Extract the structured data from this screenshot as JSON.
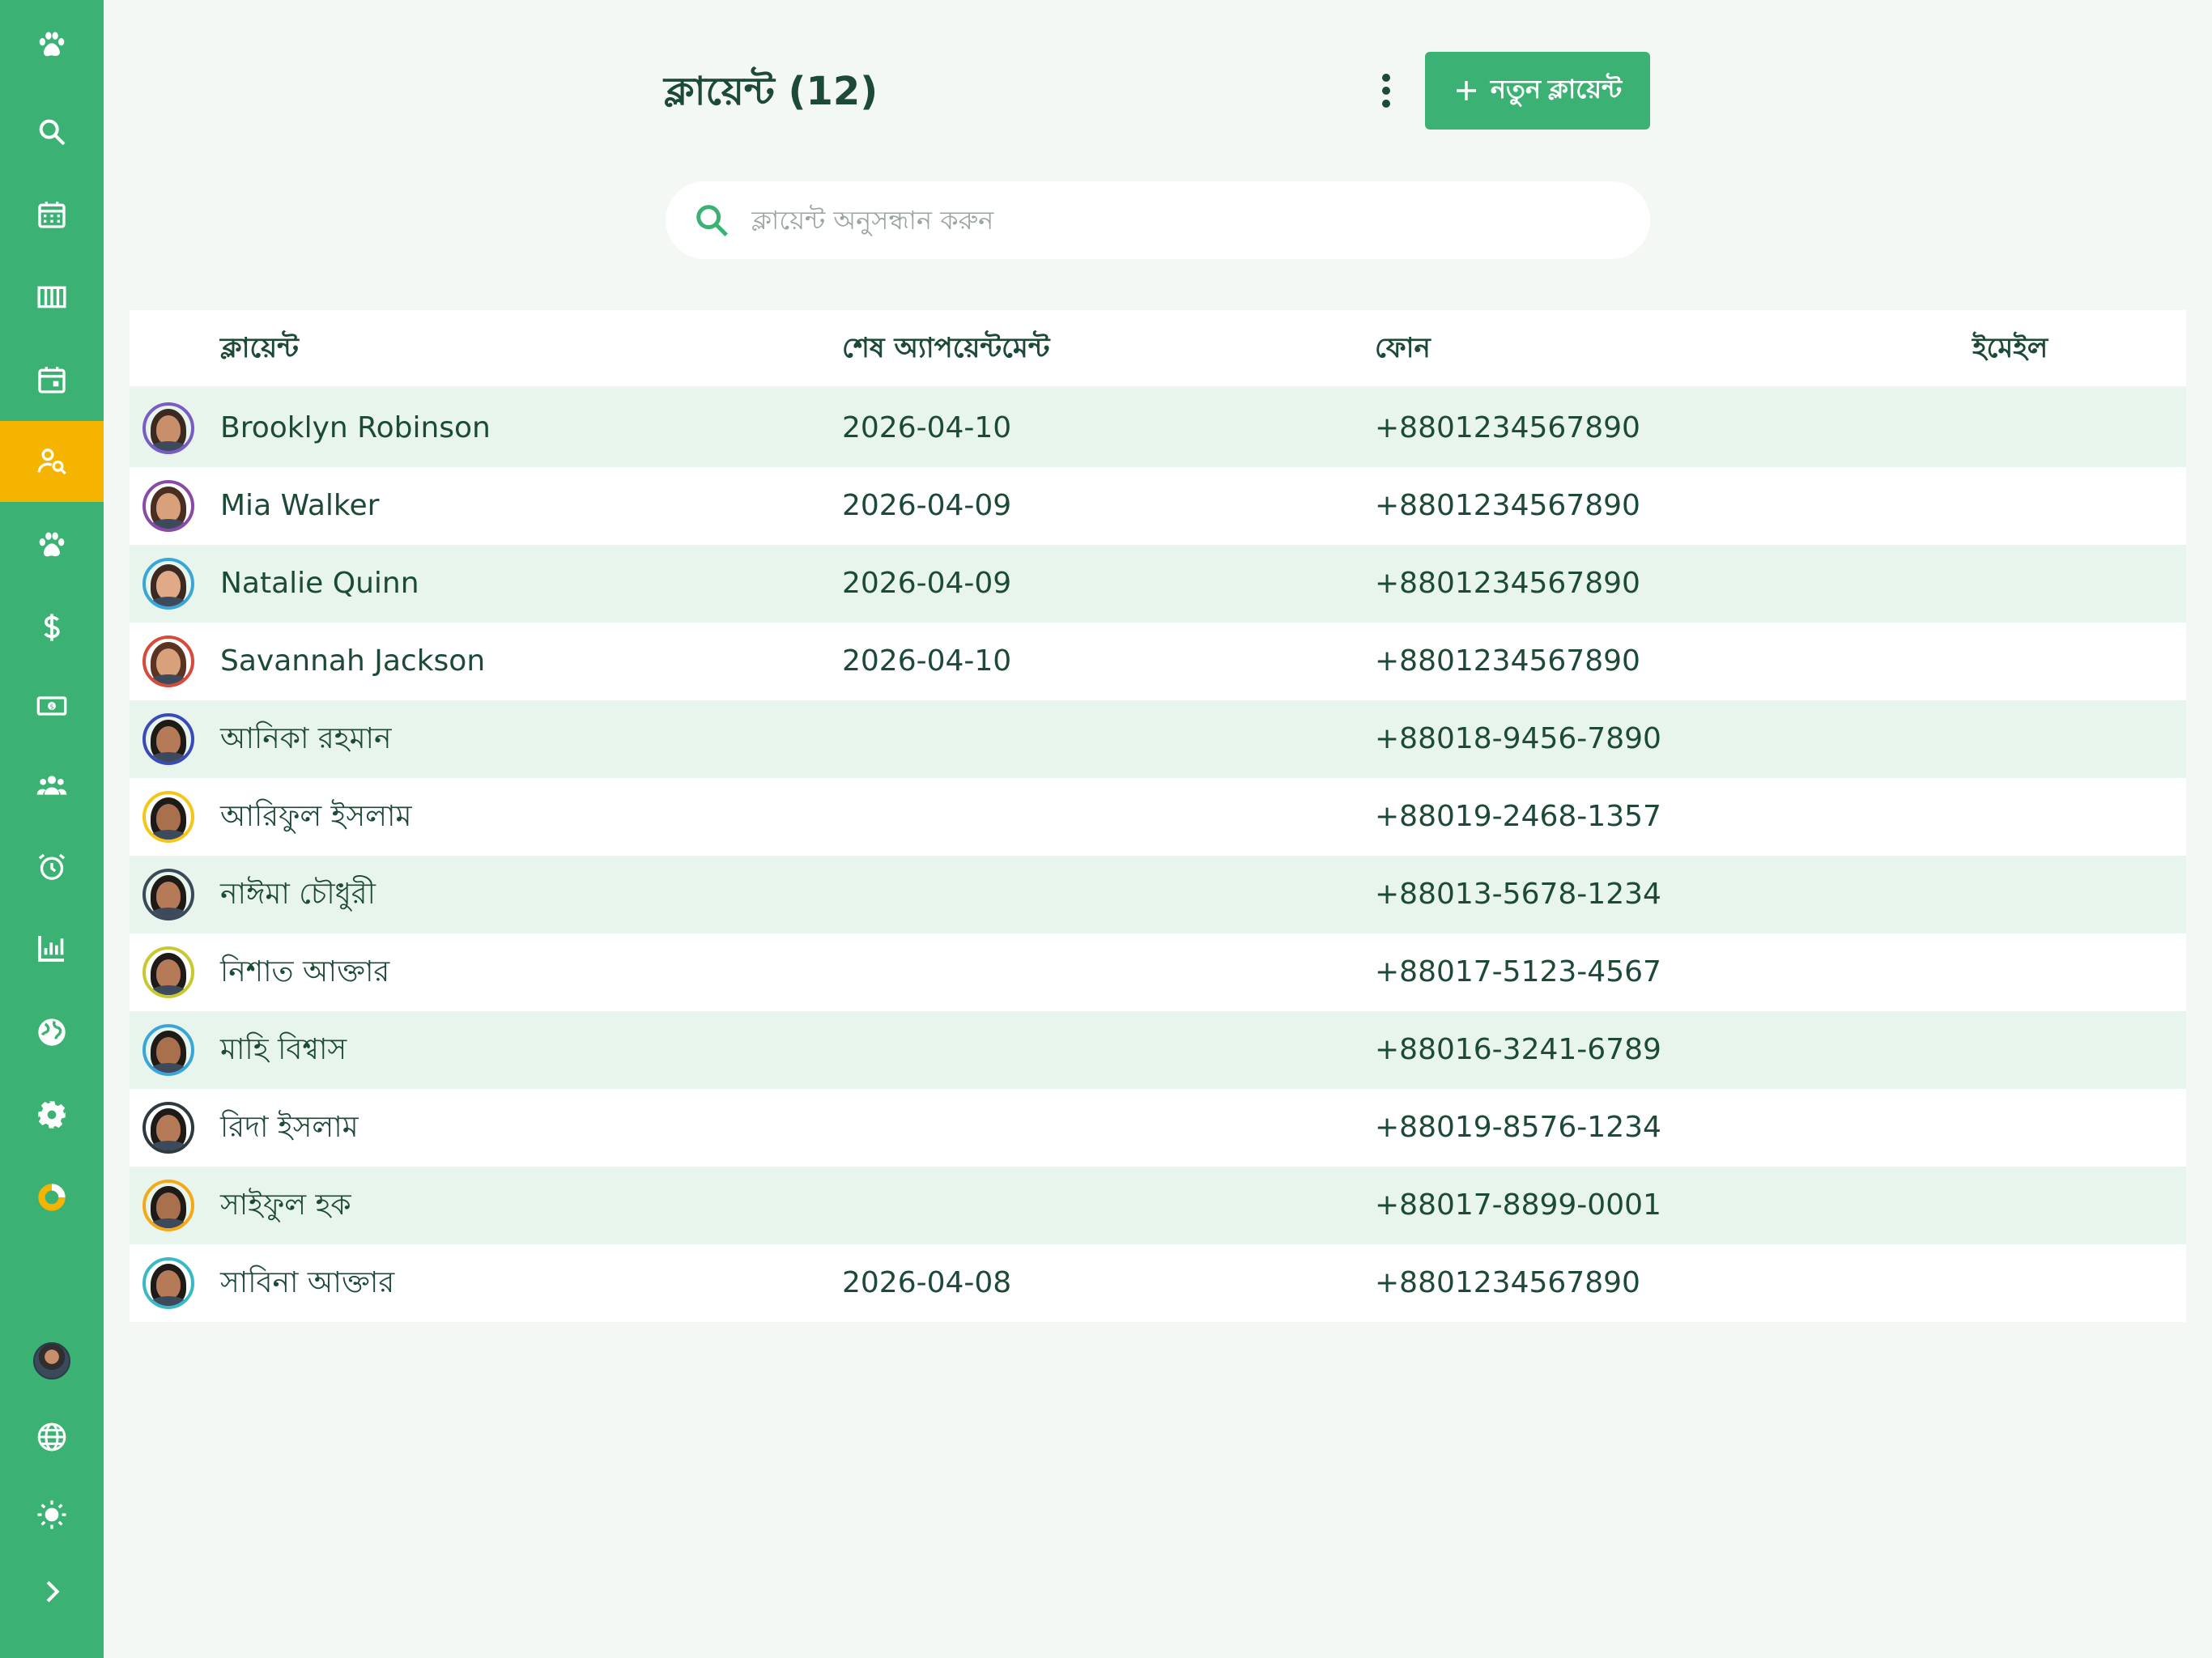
{
  "header": {
    "title": "ক্লায়েন্ট (12)",
    "add_button_label": "নতুন ক্লায়েন্ট"
  },
  "search": {
    "placeholder": "ক্লায়েন্ট অনুসন্ধান করুন",
    "value": ""
  },
  "sidebar": {
    "items": [
      {
        "icon": "paw-icon"
      },
      {
        "icon": "search-icon"
      },
      {
        "icon": "calendar-grid-icon"
      },
      {
        "icon": "columns-icon"
      },
      {
        "icon": "calendar-event-icon"
      },
      {
        "icon": "person-search-icon",
        "active": true
      },
      {
        "icon": "paw-icon"
      },
      {
        "icon": "dollar-icon"
      },
      {
        "icon": "cash-icon"
      },
      {
        "icon": "group-icon"
      },
      {
        "icon": "alarm-icon"
      },
      {
        "icon": "bar-chart-icon"
      },
      {
        "icon": "globe-filled-icon"
      },
      {
        "icon": "gear-icon"
      },
      {
        "icon": "donut-icon"
      }
    ],
    "bottom": [
      {
        "icon": "user-avatar"
      },
      {
        "icon": "language-globe-icon"
      },
      {
        "icon": "sun-icon"
      },
      {
        "icon": "chevron-right-icon"
      }
    ]
  },
  "table": {
    "columns": [
      "ক্লায়েন্ট",
      "শেষ অ্যাপয়েন্টমেন্ট",
      "ফোন",
      "ইমেইল"
    ],
    "rows": [
      {
        "name": "Brooklyn Robinson",
        "last_appointment": "2026-04-10",
        "phone": "+8801234567890",
        "email": "",
        "ring": "#7a5cc4",
        "tone": "#c98e6a",
        "hair": "#3a2a22"
      },
      {
        "name": "Mia Walker",
        "last_appointment": "2026-04-09",
        "phone": "+8801234567890",
        "email": "",
        "ring": "#8a4aa8",
        "tone": "#d9a07c",
        "hair": "#4a2e22"
      },
      {
        "name": "Natalie Quinn",
        "last_appointment": "2026-04-09",
        "phone": "+8801234567890",
        "email": "",
        "ring": "#3aa6d8",
        "tone": "#e0aa88",
        "hair": "#3a2a22"
      },
      {
        "name": "Savannah Jackson",
        "last_appointment": "2026-04-10",
        "phone": "+8801234567890",
        "email": "",
        "ring": "#d84a3a",
        "tone": "#d9a07c",
        "hair": "#5a3322"
      },
      {
        "name": "আনিকা রহমান",
        "last_appointment": "",
        "phone": "+88018-9456-7890",
        "email": "",
        "ring": "#3a4ab8",
        "tone": "#b57b58",
        "hair": "#1e1a18"
      },
      {
        "name": "আরিফুল ইসলাম",
        "last_appointment": "",
        "phone": "+88019-2468-1357",
        "email": "",
        "ring": "#f5c518",
        "tone": "#a8704c",
        "hair": "#1e1a18"
      },
      {
        "name": "নাঈমা চৌধুরী",
        "last_appointment": "",
        "phone": "+88013-5678-1234",
        "email": "",
        "ring": "#3a4a5a",
        "tone": "#b57b58",
        "hair": "#1e1a18"
      },
      {
        "name": "নিশাত আক্তার",
        "last_appointment": "",
        "phone": "+88017-5123-4567",
        "email": "",
        "ring": "#c8c830",
        "tone": "#b57b58",
        "hair": "#1e1a18"
      },
      {
        "name": "মাহি বিশ্বাস",
        "last_appointment": "",
        "phone": "+88016-3241-6789",
        "email": "",
        "ring": "#3aa6d8",
        "tone": "#a8704c",
        "hair": "#1e1a18"
      },
      {
        "name": "রিদা ইসলাম",
        "last_appointment": "",
        "phone": "+88019-8576-1234",
        "email": "",
        "ring": "#2e3a40",
        "tone": "#b57b58",
        "hair": "#1e1a18"
      },
      {
        "name": "সাইফুল হক",
        "last_appointment": "",
        "phone": "+88017-8899-0001",
        "email": "",
        "ring": "#f5a818",
        "tone": "#a8704c",
        "hair": "#1e1a18"
      },
      {
        "name": "সাবিনা আক্তার",
        "last_appointment": "2026-04-08",
        "phone": "+8801234567890",
        "email": "",
        "ring": "#3ab8c8",
        "tone": "#b57b58",
        "hair": "#1e1a18"
      }
    ]
  },
  "colors": {
    "accent": "#3bb273",
    "active": "#f5b400",
    "text": "#1c4a36",
    "row_alt": "#e8f5ec"
  }
}
